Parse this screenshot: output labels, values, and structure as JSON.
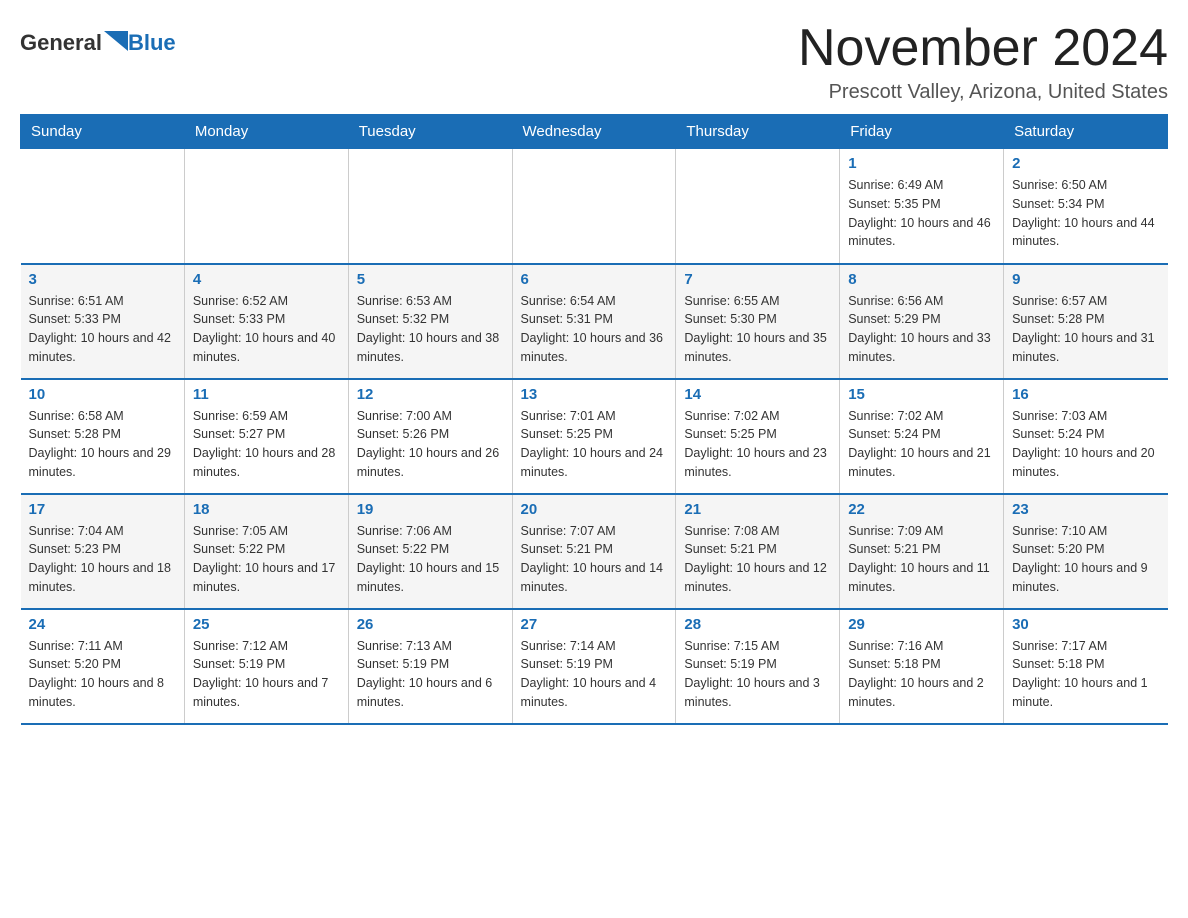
{
  "header": {
    "logo": {
      "text_general": "General",
      "text_blue": "Blue"
    },
    "month_title": "November 2024",
    "location": "Prescott Valley, Arizona, United States"
  },
  "weekdays": [
    "Sunday",
    "Monday",
    "Tuesday",
    "Wednesday",
    "Thursday",
    "Friday",
    "Saturday"
  ],
  "weeks": [
    [
      {
        "day": "",
        "sunrise": "",
        "sunset": "",
        "daylight": ""
      },
      {
        "day": "",
        "sunrise": "",
        "sunset": "",
        "daylight": ""
      },
      {
        "day": "",
        "sunrise": "",
        "sunset": "",
        "daylight": ""
      },
      {
        "day": "",
        "sunrise": "",
        "sunset": "",
        "daylight": ""
      },
      {
        "day": "",
        "sunrise": "",
        "sunset": "",
        "daylight": ""
      },
      {
        "day": "1",
        "sunrise": "Sunrise: 6:49 AM",
        "sunset": "Sunset: 5:35 PM",
        "daylight": "Daylight: 10 hours and 46 minutes."
      },
      {
        "day": "2",
        "sunrise": "Sunrise: 6:50 AM",
        "sunset": "Sunset: 5:34 PM",
        "daylight": "Daylight: 10 hours and 44 minutes."
      }
    ],
    [
      {
        "day": "3",
        "sunrise": "Sunrise: 6:51 AM",
        "sunset": "Sunset: 5:33 PM",
        "daylight": "Daylight: 10 hours and 42 minutes."
      },
      {
        "day": "4",
        "sunrise": "Sunrise: 6:52 AM",
        "sunset": "Sunset: 5:33 PM",
        "daylight": "Daylight: 10 hours and 40 minutes."
      },
      {
        "day": "5",
        "sunrise": "Sunrise: 6:53 AM",
        "sunset": "Sunset: 5:32 PM",
        "daylight": "Daylight: 10 hours and 38 minutes."
      },
      {
        "day": "6",
        "sunrise": "Sunrise: 6:54 AM",
        "sunset": "Sunset: 5:31 PM",
        "daylight": "Daylight: 10 hours and 36 minutes."
      },
      {
        "day": "7",
        "sunrise": "Sunrise: 6:55 AM",
        "sunset": "Sunset: 5:30 PM",
        "daylight": "Daylight: 10 hours and 35 minutes."
      },
      {
        "day": "8",
        "sunrise": "Sunrise: 6:56 AM",
        "sunset": "Sunset: 5:29 PM",
        "daylight": "Daylight: 10 hours and 33 minutes."
      },
      {
        "day": "9",
        "sunrise": "Sunrise: 6:57 AM",
        "sunset": "Sunset: 5:28 PM",
        "daylight": "Daylight: 10 hours and 31 minutes."
      }
    ],
    [
      {
        "day": "10",
        "sunrise": "Sunrise: 6:58 AM",
        "sunset": "Sunset: 5:28 PM",
        "daylight": "Daylight: 10 hours and 29 minutes."
      },
      {
        "day": "11",
        "sunrise": "Sunrise: 6:59 AM",
        "sunset": "Sunset: 5:27 PM",
        "daylight": "Daylight: 10 hours and 28 minutes."
      },
      {
        "day": "12",
        "sunrise": "Sunrise: 7:00 AM",
        "sunset": "Sunset: 5:26 PM",
        "daylight": "Daylight: 10 hours and 26 minutes."
      },
      {
        "day": "13",
        "sunrise": "Sunrise: 7:01 AM",
        "sunset": "Sunset: 5:25 PM",
        "daylight": "Daylight: 10 hours and 24 minutes."
      },
      {
        "day": "14",
        "sunrise": "Sunrise: 7:02 AM",
        "sunset": "Sunset: 5:25 PM",
        "daylight": "Daylight: 10 hours and 23 minutes."
      },
      {
        "day": "15",
        "sunrise": "Sunrise: 7:02 AM",
        "sunset": "Sunset: 5:24 PM",
        "daylight": "Daylight: 10 hours and 21 minutes."
      },
      {
        "day": "16",
        "sunrise": "Sunrise: 7:03 AM",
        "sunset": "Sunset: 5:24 PM",
        "daylight": "Daylight: 10 hours and 20 minutes."
      }
    ],
    [
      {
        "day": "17",
        "sunrise": "Sunrise: 7:04 AM",
        "sunset": "Sunset: 5:23 PM",
        "daylight": "Daylight: 10 hours and 18 minutes."
      },
      {
        "day": "18",
        "sunrise": "Sunrise: 7:05 AM",
        "sunset": "Sunset: 5:22 PM",
        "daylight": "Daylight: 10 hours and 17 minutes."
      },
      {
        "day": "19",
        "sunrise": "Sunrise: 7:06 AM",
        "sunset": "Sunset: 5:22 PM",
        "daylight": "Daylight: 10 hours and 15 minutes."
      },
      {
        "day": "20",
        "sunrise": "Sunrise: 7:07 AM",
        "sunset": "Sunset: 5:21 PM",
        "daylight": "Daylight: 10 hours and 14 minutes."
      },
      {
        "day": "21",
        "sunrise": "Sunrise: 7:08 AM",
        "sunset": "Sunset: 5:21 PM",
        "daylight": "Daylight: 10 hours and 12 minutes."
      },
      {
        "day": "22",
        "sunrise": "Sunrise: 7:09 AM",
        "sunset": "Sunset: 5:21 PM",
        "daylight": "Daylight: 10 hours and 11 minutes."
      },
      {
        "day": "23",
        "sunrise": "Sunrise: 7:10 AM",
        "sunset": "Sunset: 5:20 PM",
        "daylight": "Daylight: 10 hours and 9 minutes."
      }
    ],
    [
      {
        "day": "24",
        "sunrise": "Sunrise: 7:11 AM",
        "sunset": "Sunset: 5:20 PM",
        "daylight": "Daylight: 10 hours and 8 minutes."
      },
      {
        "day": "25",
        "sunrise": "Sunrise: 7:12 AM",
        "sunset": "Sunset: 5:19 PM",
        "daylight": "Daylight: 10 hours and 7 minutes."
      },
      {
        "day": "26",
        "sunrise": "Sunrise: 7:13 AM",
        "sunset": "Sunset: 5:19 PM",
        "daylight": "Daylight: 10 hours and 6 minutes."
      },
      {
        "day": "27",
        "sunrise": "Sunrise: 7:14 AM",
        "sunset": "Sunset: 5:19 PM",
        "daylight": "Daylight: 10 hours and 4 minutes."
      },
      {
        "day": "28",
        "sunrise": "Sunrise: 7:15 AM",
        "sunset": "Sunset: 5:19 PM",
        "daylight": "Daylight: 10 hours and 3 minutes."
      },
      {
        "day": "29",
        "sunrise": "Sunrise: 7:16 AM",
        "sunset": "Sunset: 5:18 PM",
        "daylight": "Daylight: 10 hours and 2 minutes."
      },
      {
        "day": "30",
        "sunrise": "Sunrise: 7:17 AM",
        "sunset": "Sunset: 5:18 PM",
        "daylight": "Daylight: 10 hours and 1 minute."
      }
    ]
  ]
}
